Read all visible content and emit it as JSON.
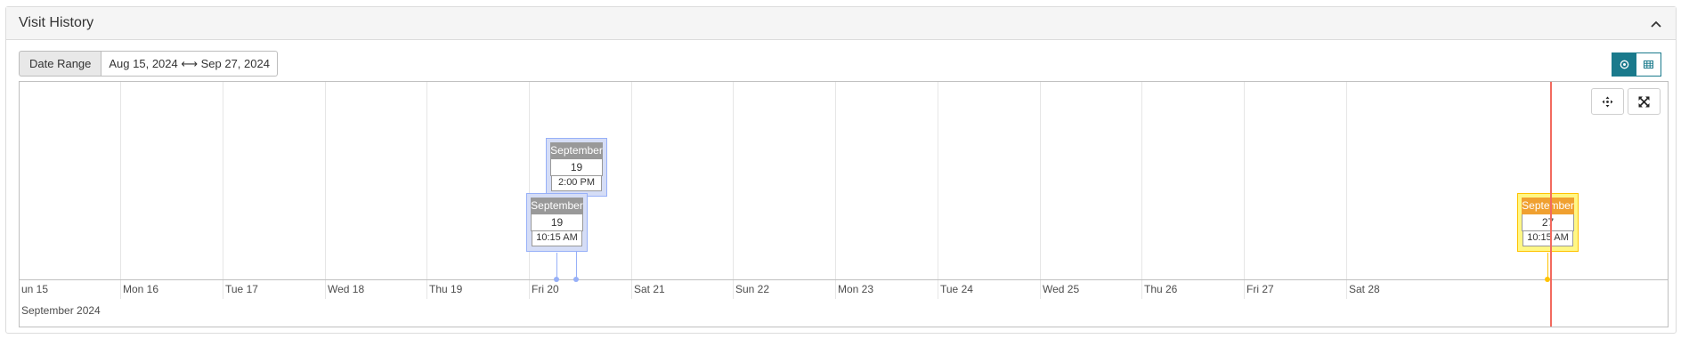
{
  "panel": {
    "title": "Visit History",
    "collapse_icon": "chevron-up-icon"
  },
  "toolbar": {
    "date_range_label": "Date Range",
    "date_range_value": "Aug 15, 2024 ⟷ Sep 27, 2024"
  },
  "view_toggle": {
    "timeline_icon": "target-icon",
    "table_icon": "table-icon",
    "active": "timeline"
  },
  "timeline": {
    "ticks": [
      "un 15",
      "Mon 16",
      "Tue 17",
      "Wed 18",
      "Thu 19",
      "Fri 20",
      "Sat 21",
      "Sun 22",
      "Mon 23",
      "Tue 24",
      "Wed 25",
      "Thu 26",
      "Fri 27",
      "Sat 28"
    ],
    "major_label": "September 2024",
    "fit_icon": "crosshair-move-icon",
    "fullscreen_icon": "expand-icon",
    "events": [
      {
        "month": "September",
        "day": "19",
        "time": "2:00 PM"
      },
      {
        "month": "September",
        "day": "19",
        "time": "10:15 AM"
      },
      {
        "month": "September",
        "day": "27",
        "time": "10:15 AM"
      }
    ]
  },
  "colors": {
    "accent": "#1a7a8c",
    "now_line": "#f26a5f",
    "event_bg": "#d5ddf6",
    "event_border": "#97b0f8",
    "highlight_bg": "#fff785",
    "highlight_border": "#ffc200"
  }
}
